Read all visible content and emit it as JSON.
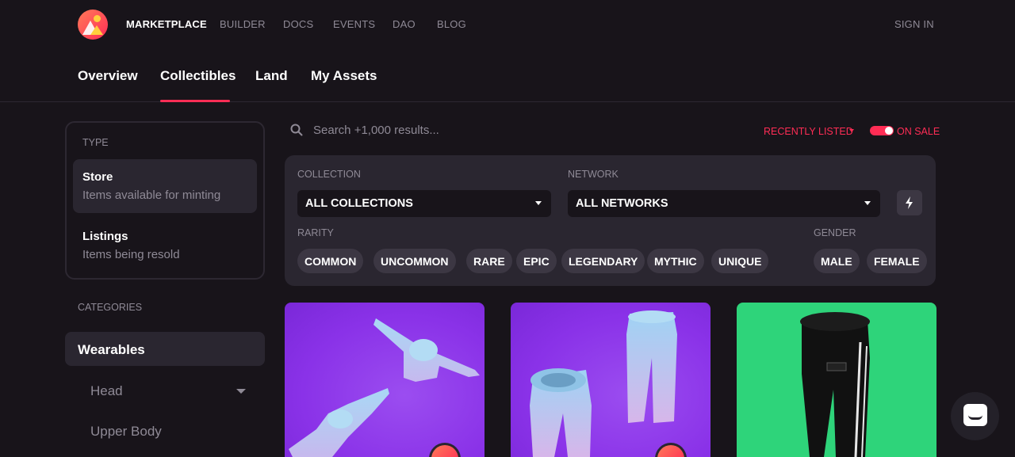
{
  "topnav": {
    "items": [
      {
        "label": "MARKETPLACE",
        "active": true
      },
      {
        "label": "BUILDER"
      },
      {
        "label": "DOCS"
      },
      {
        "label": "EVENTS"
      },
      {
        "label": "DAO"
      },
      {
        "label": "BLOG"
      }
    ],
    "signin": "SIGN IN"
  },
  "subnav": {
    "tabs": [
      {
        "label": "Overview"
      },
      {
        "label": "Collectibles",
        "active": true
      },
      {
        "label": "Land"
      },
      {
        "label": "My Assets"
      }
    ]
  },
  "sidebar": {
    "type_header": "TYPE",
    "types": [
      {
        "title": "Store",
        "desc": "Items available for minting",
        "selected": true
      },
      {
        "title": "Listings",
        "desc": "Items being resold"
      }
    ],
    "categories_header": "CATEGORIES",
    "selected_category": "Wearables",
    "subcategories": [
      "Head",
      "Upper Body"
    ]
  },
  "search": {
    "placeholder": "Search +1,000 results..."
  },
  "sort": {
    "label": "RECENTLY LISTED"
  },
  "on_sale": {
    "label": "ON SALE",
    "enabled": true
  },
  "filters": {
    "collection_label": "COLLECTION",
    "collection_value": "ALL COLLECTIONS",
    "network_label": "NETWORK",
    "network_value": "ALL NETWORKS",
    "rarity_label": "RARITY",
    "rarities": [
      "COMMON",
      "UNCOMMON",
      "RARE",
      "EPIC",
      "LEGENDARY",
      "MYTHIC",
      "UNIQUE"
    ],
    "gender_label": "GENDER",
    "genders": [
      "MALE",
      "FEMALE"
    ]
  },
  "cards": [
    {
      "bg": "purple",
      "item": "hoodie"
    },
    {
      "bg": "purple",
      "item": "pants"
    },
    {
      "bg": "green",
      "item": "black-pants"
    }
  ],
  "colors": {
    "accent": "#ff2d55",
    "bg": "#18141a",
    "panel": "#2a2630",
    "muted": "#8f8a96"
  }
}
